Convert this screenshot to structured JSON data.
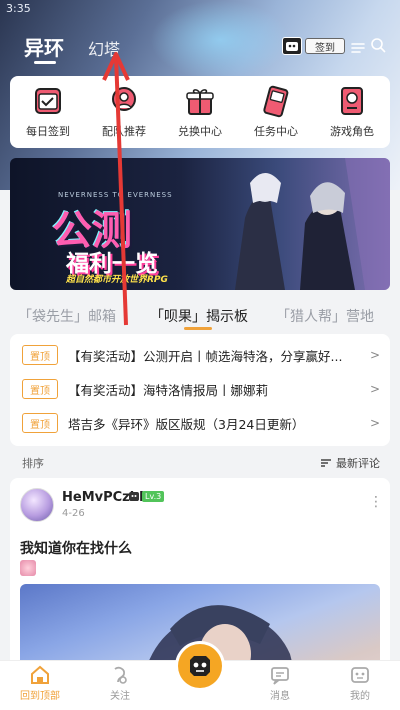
{
  "status": {
    "time": "3:35"
  },
  "header": {
    "tab_main": "异环",
    "tab_second": "幻塔",
    "checkin_label": "签到",
    "colors": {
      "accent": "#f0a23a"
    }
  },
  "quick_actions": [
    {
      "label": "每日签到",
      "icon": "calendar-check-icon",
      "color": "#e84a5f"
    },
    {
      "label": "配队推荐",
      "icon": "team-icon",
      "color": "#e84a5f"
    },
    {
      "label": "兑换中心",
      "icon": "gift-icon",
      "color": "#e84a5f"
    },
    {
      "label": "任务中心",
      "icon": "task-device-icon",
      "color": "#e84a5f"
    },
    {
      "label": "游戏角色",
      "icon": "character-card-icon",
      "color": "#e84a5f"
    }
  ],
  "banner": {
    "topline": "NEVERNESS TO EVERNESS",
    "title1": "公测",
    "title2": "福利一览",
    "subtitle": "超自然都市开放世界RPG"
  },
  "section_tabs": [
    {
      "label": "「袋先生」邮箱"
    },
    {
      "label": "「呗果」揭示板"
    },
    {
      "label": "「猎人帮」营地"
    }
  ],
  "notices": [
    {
      "badge": "置顶",
      "text": "【有奖活动】公测开启丨帧选海特洛，分享赢好..."
    },
    {
      "badge": "置顶",
      "text": "【有奖活动】海特洛情报局丨娜娜莉"
    },
    {
      "badge": "置顶",
      "text": "塔吉多《异环》版区版规（3月24日更新）"
    }
  ],
  "sort": {
    "label": "排序",
    "latest": "最新评论"
  },
  "post": {
    "username": "HeMvPCzhK",
    "level": "Lv.3",
    "date": "4-26",
    "title": "我知道你在找什么"
  },
  "bottom_nav": [
    {
      "label": "回到顶部"
    },
    {
      "label": "关注"
    },
    {
      "label": "消息"
    },
    {
      "label": "我的"
    }
  ]
}
